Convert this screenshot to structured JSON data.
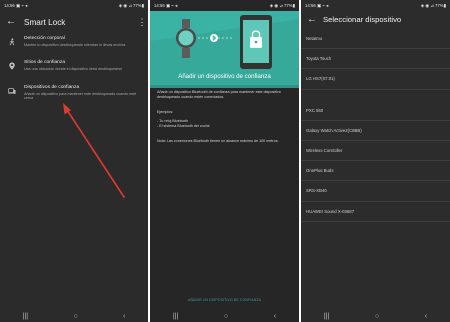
{
  "screen1": {
    "status": {
      "time": "14:56",
      "icons_left": "▣ ⌁ ◂",
      "icons_right": "◈ ◉ ⊿ 77%▮"
    },
    "title": "Smart Lock",
    "items": [
      {
        "title": "Detección corporal",
        "subtitle": "Mantén tu dispositivo desbloqueado mientras lo llevas encima",
        "icon": "walking-person-icon"
      },
      {
        "title": "Sitios de confianza",
        "subtitle": "Usa una ubicación donde el dispositivo deba desbloquearse",
        "icon": "location-pin-icon"
      },
      {
        "title": "Dispositivos de confianza",
        "subtitle": "Añade un dispositivo para mantener este desbloqueado cuando esté cerca",
        "icon": "devices-icon"
      }
    ],
    "nav": [
      "|||",
      "○",
      "‹"
    ]
  },
  "screen2": {
    "status": {
      "time": "14:56",
      "icons_left": "▣ ⌁ ◂",
      "icons_right": "◈ ◉ ⊿ 77%▮"
    },
    "hero_caption": "Añadir un dispositivo de confianza",
    "description": "Añade un dispositivo Bluetooth de confianza para mantener este dispositivo desbloqueado cuando estén conectados.",
    "examples_label": "Ejemplos:",
    "examples": [
      "- Tu reloj Bluetooth",
      "- El sistema Bluetooth del coche"
    ],
    "note": "Nota: Las conexiones Bluetooth tienen un alcance máximo de 100 metros.",
    "action": "AÑADIR UN DISPOSITIVO DE CONFIANZA",
    "nav": [
      "|||",
      "○",
      "‹"
    ]
  },
  "screen3": {
    "status": {
      "time": "14:56",
      "icons_left": "▣ ⌁ ◂",
      "icons_right": "◈ ◉ ⊿ 77%▮"
    },
    "title": "Seleccionar dispositivo",
    "devices": [
      "Netatmo",
      "Toyota Touch",
      "LG HS7(07:01)",
      "",
      "PXC 550",
      "Galaxy Watch Active2(C8BB)",
      "Wireless Controller",
      "OnePlus Buds",
      "SRS-XB40",
      "HUAWEI Sound X-03687"
    ],
    "nav": [
      "|||",
      "○",
      "‹"
    ]
  },
  "colors": {
    "accent": "#36a99b",
    "arrow": "#e03a2e",
    "link": "#3a9ea3"
  }
}
